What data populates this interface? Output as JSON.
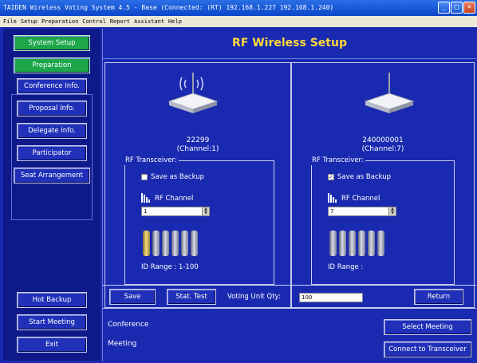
{
  "window": {
    "title": "TAIDEN Wireless Voting System 4.5 - Base (Connected: (RT) 192.168.1.227 192.168.1.240)",
    "controls": [
      "_",
      "□",
      "✕"
    ]
  },
  "menu": [
    "File",
    "Setup",
    "Preparation",
    "Control",
    "Report",
    "Assistant",
    "Help"
  ],
  "sidebar": {
    "system_setup": "System Setup",
    "preparation": "Preparation",
    "items": [
      "Conference Info.",
      "Proposal Info.",
      "Delegate Info.",
      "Participator",
      "Seat Arrangement"
    ],
    "hot_backup": "Hot Backup",
    "start_meeting": "Start Meeting",
    "exit": "Exit"
  },
  "header": {
    "title": "RF Wireless Setup"
  },
  "devices": [
    {
      "name": "22299",
      "channel": "(Channel:1)",
      "transceiver_title": "RF Transceiver:",
      "save_backup_label": "Save as Backup",
      "save_backup_checked": "",
      "rf_channel_label": "RF Channel",
      "rf_channel_value": "1",
      "id_range": "ID Range : 1-100"
    },
    {
      "name": "240000001",
      "channel": "(Channel:7)",
      "transceiver_title": "RF Transceiver:",
      "save_backup_label": "Save as Backup",
      "save_backup_checked": "✓",
      "rf_channel_label": "RF Channel",
      "rf_channel_value": "7",
      "id_range": "ID Range :"
    }
  ],
  "toolbar": {
    "save": "Save",
    "stat_test": "Stat. Test",
    "qty_label": "Voting Unit Qty:",
    "qty_value": "100",
    "return": "Return"
  },
  "status": {
    "conference_label": "Conference",
    "meeting_label": "Meeting",
    "select_meeting": "Select Meeting",
    "connect_transceiver": "Connect to Transceiver"
  },
  "colors": {
    "background": "#1a2ab0",
    "header_text": "#ffd93a",
    "green_button": "#1da64a"
  }
}
